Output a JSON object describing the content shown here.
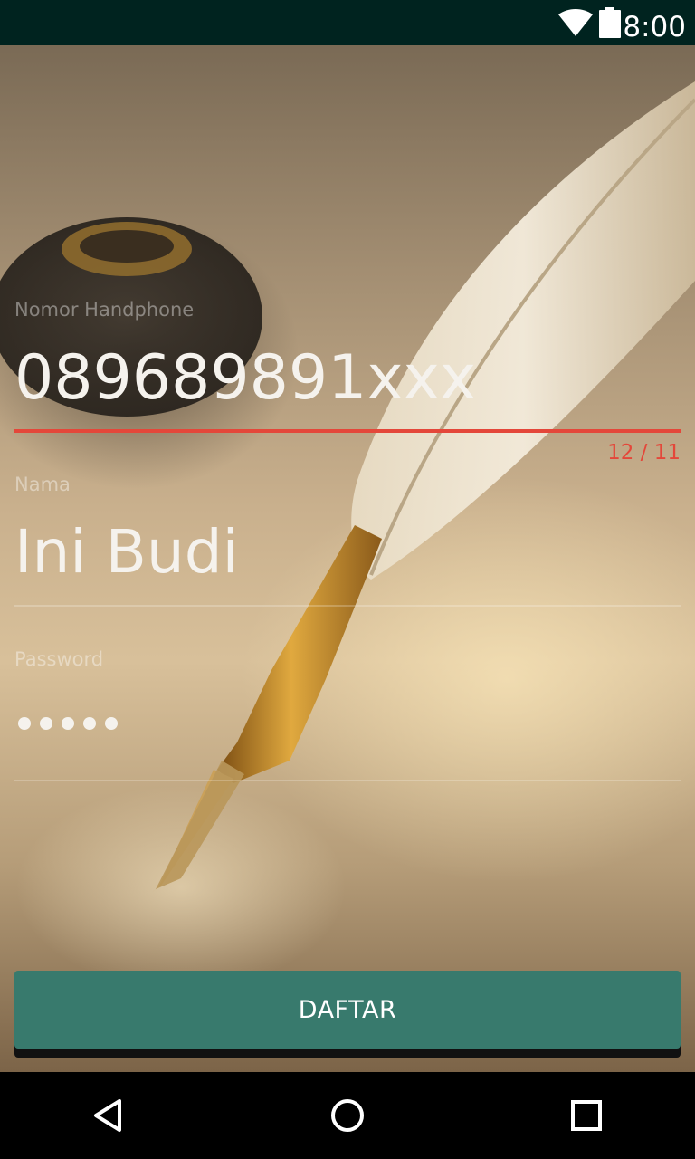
{
  "status_bar": {
    "time": "8:00",
    "icons": [
      "wifi-icon",
      "battery-icon"
    ]
  },
  "form": {
    "phone": {
      "label": "Nomor Handphone",
      "value": "089689891xxx",
      "counter": "12 / 11",
      "state": "error"
    },
    "name": {
      "label": "Nama",
      "value": "Ini Budi"
    },
    "password": {
      "label": "Password",
      "masked_length": 5
    }
  },
  "button": {
    "label": "DAFTAR"
  },
  "nav_bar": {
    "icons": [
      "back-icon",
      "home-icon",
      "recents-icon"
    ]
  },
  "colors": {
    "status_bar_bg": "#00231f",
    "accent_button": "#387a6d",
    "error": "#e4473a"
  }
}
